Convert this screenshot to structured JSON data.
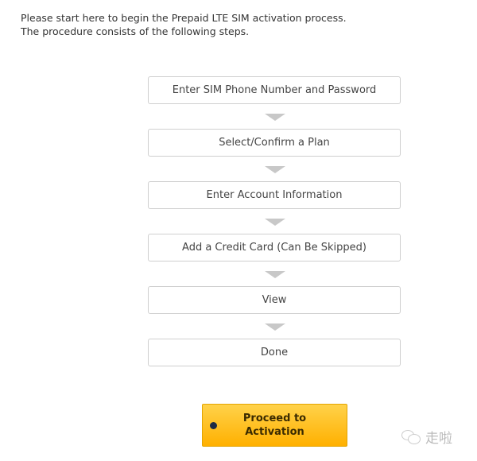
{
  "intro": {
    "line1": "Please start here to begin the Prepaid LTE SIM activation process.",
    "line2": "The procedure consists of the following steps."
  },
  "steps": [
    {
      "label": "Enter SIM Phone Number and Password"
    },
    {
      "label": "Select/Confirm a Plan"
    },
    {
      "label": "Enter Account Information"
    },
    {
      "label": "Add a Credit Card (Can Be Skipped)"
    },
    {
      "label": "View"
    },
    {
      "label": "Done"
    }
  ],
  "proceed_button": {
    "label": "Proceed to\nActivation",
    "icon": "circle-arrow-icon",
    "color": "#ffc21a"
  },
  "watermark": {
    "text": "走啦",
    "icon": "wechat-icon"
  }
}
